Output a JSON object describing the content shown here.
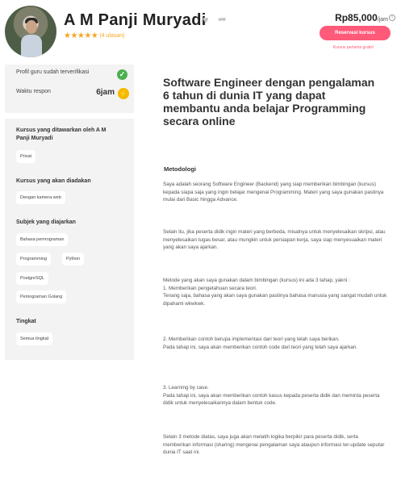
{
  "tutor": {
    "name": "A M Panji Muryadi",
    "stars": "★★★★★",
    "reviews": "(4 ulasan)"
  },
  "pricing": {
    "price": "Rp85,000",
    "unit": "/jam",
    "reserve_label": "Reservasi kursus",
    "first_lesson": "Kursus pertama gratis!"
  },
  "profile": {
    "verified_label": "Profil guru sudah terverifikasi",
    "response_label": "Waktu respon",
    "response_value": "6jam"
  },
  "sidebar": {
    "offered_title": "Kursus yang ditawarkan oleh A M Panji Muryadi",
    "offered_items": [
      "Privat"
    ],
    "held_title": "Kursus yang akan diadakan",
    "held_items": [
      "Dengan kamera web"
    ],
    "subjects_title": "Subjek yang diajarkan",
    "subjects": [
      "Bahasa pemrograman",
      "Programming",
      "Python",
      "PostgreSQL",
      "Pemograman Golang"
    ],
    "level_title": "Tingkat",
    "levels": [
      "Semua tingkat"
    ]
  },
  "content": {
    "title": "Software Engineer dengan pengalaman 6 tahun di dunia IT yang dapat membantu anda belajar Programming secara online",
    "section_title": "Metodologi",
    "paragraphs": [
      "Saya adalah seorang Software Engineer (Backend) yang siap memberikan bimbingan (kursus) kepada siapa saja yang ingin belajar mengenai Programming. Materi yang saya gunakan pastinya mulai dari Basic hingga Advance.",
      "Selain itu, jika peserta didik ingin materi yang berbeda, misalnya untuk menyelesaikan skripsi, atau menyelesaikan tugas besar, atau mungkin untuk persiapan kerja, saya siap menyesuaikan materi yang akan saya ajarkan.",
      "Metode yang akan saya gunakan dalam bimbingan (kursus) ini ada 3 tahap, yakni :\n1. Memberikan pengetahuan secara teori.\nTenang saja, bahasa yang akan saya gunakan pastinya bahasa manusia yang sangat mudah untuk dipahami wkwkwk.",
      "2. Memberikan contoh berupa implementasi dari teori yang telah saya berikan.\nPada tahap ini, saya akan memberikan contoh code dari teori yang telah saya ajarkan.",
      "3. Learning by case.\nPada tahap ini, saya akan memberikan contoh kasus kepada peserta didik dan meminta peserta didik untuk menyelesaikannya dalam bentuk code.",
      "Selain 3 metode diatas, saya juga akan melatih logika berpikir para peserta didik, serta memberikan informasi (sharing) mengenai pengalaman saya ataupun informasi ter-update seputar dunia IT saat ini."
    ]
  }
}
